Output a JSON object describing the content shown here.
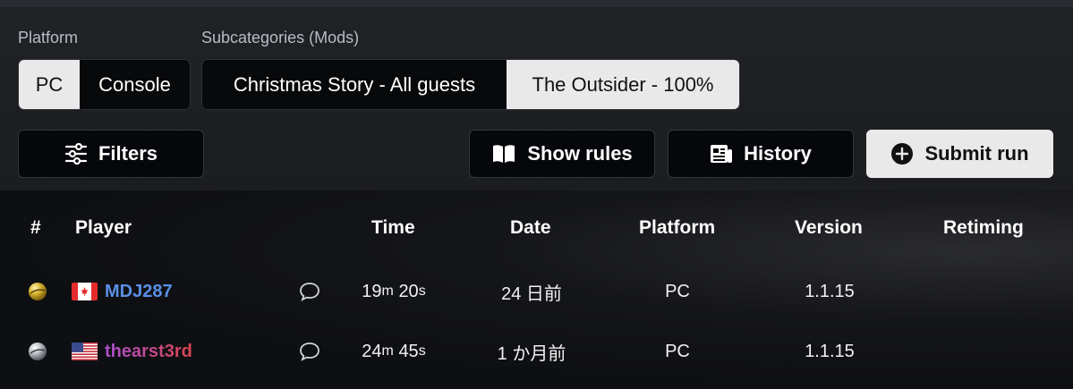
{
  "filters": {
    "platform_label": "Platform",
    "platform_options": [
      "PC",
      "Console"
    ],
    "platform_selected": "PC",
    "subcategory_label": "Subcategories (Mods)",
    "subcategory_options": [
      "Christmas Story - All guests",
      "The Outsider - 100%"
    ],
    "subcategory_selected": "The Outsider - 100%"
  },
  "actions": {
    "filters": "Filters",
    "show_rules": "Show rules",
    "history": "History",
    "submit_run": "Submit run"
  },
  "table": {
    "headers": {
      "rank": "#",
      "player": "Player",
      "time": "Time",
      "date": "Date",
      "platform": "Platform",
      "version": "Version",
      "retiming": "Retiming"
    },
    "rows": [
      {
        "medal": "gold-medal",
        "flag": "canada-flag",
        "player": "MDJ287",
        "player_color": "#5b8fe6",
        "time_m": "19",
        "time_s": "20",
        "date": "24 日前",
        "platform": "PC",
        "version": "1.1.15"
      },
      {
        "medal": "silver-medal",
        "flag": "usa-flag",
        "player": "thearst3rd",
        "player_color": "#c9436b",
        "time_m": "24",
        "time_s": "45",
        "date": "1 か月前",
        "platform": "PC",
        "version": "1.1.15"
      }
    ],
    "time_units": {
      "m": "m",
      "s": "s"
    }
  },
  "colors": {
    "accent_light": "#e9e9ea",
    "panel": "#1e2024",
    "button_dark": "#06070a"
  }
}
